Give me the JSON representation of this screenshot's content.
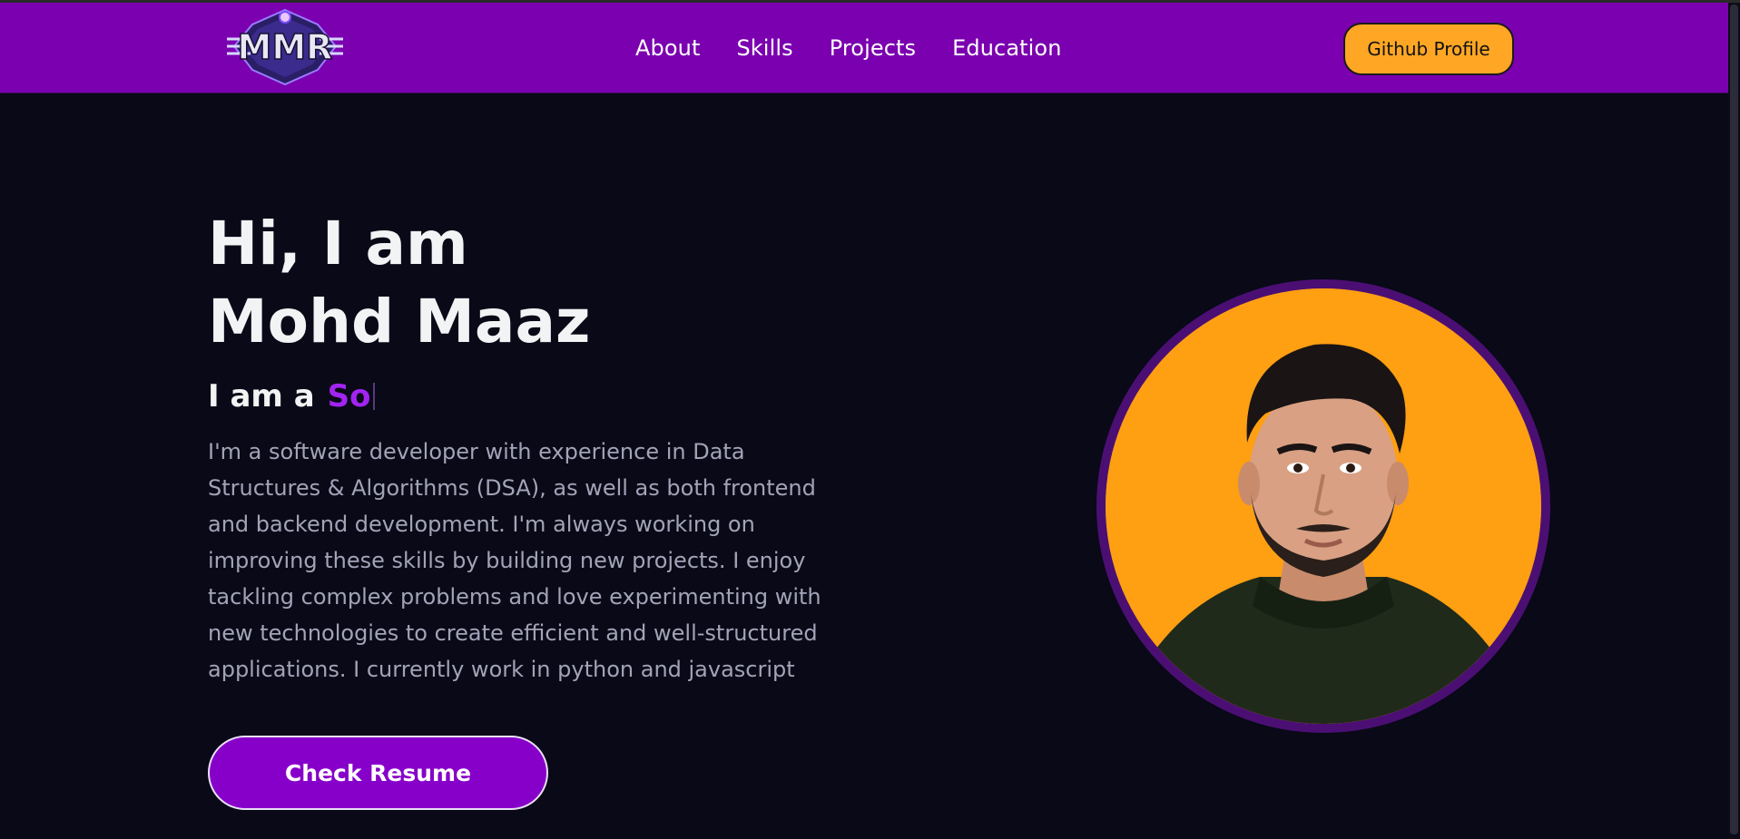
{
  "nav": {
    "logo_text": "MMR",
    "links": [
      "About",
      "Skills",
      "Projects",
      "Education"
    ],
    "cta_label": "Github Profile"
  },
  "hero": {
    "greeting": "Hi, I am",
    "name": "Mohd Maaz",
    "typing_prefix": "I am a",
    "typing_word": "So",
    "bio": "I'm a software developer with experience in Data Structures & Algorithms (DSA), as well as both frontend and backend development. I'm always working on improving these skills by building new projects. I enjoy tackling complex problems and love experimenting with new technologies to create efficient and well-structured applications. I currently work in python and javascript",
    "resume_label": "Check Resume"
  },
  "colors": {
    "navbar_bg": "#7b00b0",
    "page_bg": "#090917",
    "accent_purple": "#a224f0",
    "cta_orange": "#ffa724",
    "button_purple": "#8700c9",
    "avatar_bg": "#ff9f12",
    "avatar_ring": "#4b0f73"
  },
  "icons": {
    "logo": "mmr-logo-emblem",
    "profile": "profile-photo"
  }
}
